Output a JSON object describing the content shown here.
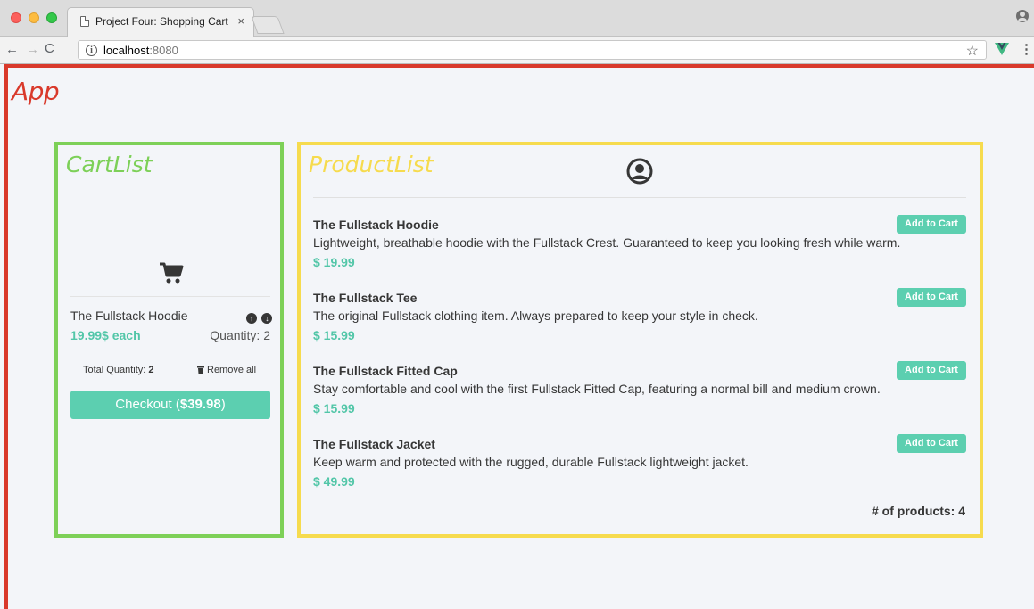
{
  "browser": {
    "tab_title": "Project Four: Shopping Cart",
    "tab_close": "×",
    "url_host": "localhost",
    "url_port": ":8080",
    "info_glyph": "i",
    "star_glyph": "☆",
    "menu_glyph": "⋮",
    "back_glyph": "←",
    "forward_glyph": "→",
    "reload_glyph": "C"
  },
  "app": {
    "label": "App"
  },
  "cart": {
    "label": "CartList",
    "item": {
      "name": "The Fullstack Hoodie",
      "up_glyph": "↑",
      "down_glyph": "↓",
      "price": "19.99$ each",
      "quantity": "Quantity: 2"
    },
    "total_label": "Total Quantity:",
    "total_value": "2",
    "remove_all": "Remove all",
    "checkout_label": "Checkout (",
    "checkout_amount": "$39.98",
    "checkout_suffix": ")"
  },
  "products": {
    "label": "ProductList",
    "add_label": "Add to Cart",
    "items": [
      {
        "title": "The Fullstack Hoodie",
        "description": "Lightweight, breathable hoodie with the Fullstack Crest. Guaranteed to keep you looking fresh while warm.",
        "price": "$ 19.99"
      },
      {
        "title": "The Fullstack Tee",
        "description": "The original Fullstack clothing item. Always prepared to keep your style in check.",
        "price": "$ 15.99"
      },
      {
        "title": "The Fullstack Fitted Cap",
        "description": "Stay comfortable and cool with the first Fullstack Fitted Cap, featuring a normal bill and medium crown.",
        "price": "$ 15.99"
      },
      {
        "title": "The Fullstack Jacket",
        "description": "Keep warm and protected with the rugged, durable Fullstack lightweight jacket.",
        "price": "$ 49.99"
      }
    ],
    "count_label": "# of products: 4"
  },
  "colors": {
    "app_red": "#d9392b",
    "cart_green": "#7dd058",
    "product_yellow": "#f6db4e",
    "accent_teal": "#5ccfb0"
  },
  "icons": [
    "page-icon",
    "info-icon",
    "star-icon",
    "vue-devtools-icon",
    "profile-icon",
    "shopping-cart-icon",
    "user-circle-icon",
    "trash-icon",
    "arrow-up-circle-icon",
    "arrow-down-circle-icon"
  ]
}
